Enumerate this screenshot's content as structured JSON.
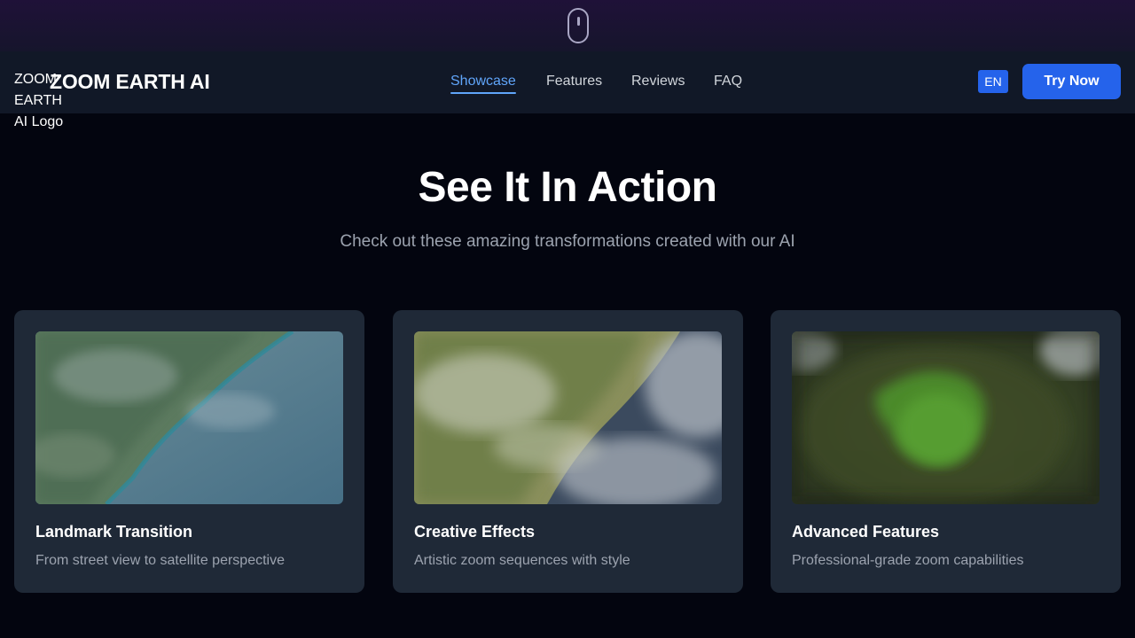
{
  "scroll_indicator": {
    "icon": "mouse-icon"
  },
  "header": {
    "logo_alt": "ZOOM EARTH AI Logo",
    "brand": "ZOOM EARTH AI",
    "nav": [
      {
        "label": "Showcase",
        "active": true
      },
      {
        "label": "Features",
        "active": false
      },
      {
        "label": "Reviews",
        "active": false
      },
      {
        "label": "FAQ",
        "active": false
      }
    ],
    "language": "EN",
    "cta": "Try Now"
  },
  "showcase": {
    "title": "See It In Action",
    "subtitle": "Check out these amazing transformations created with our AI",
    "cards": [
      {
        "title": "Landmark Transition",
        "description": "From street view to satellite perspective"
      },
      {
        "title": "Creative Effects",
        "description": "Artistic zoom sequences with style"
      },
      {
        "title": "Advanced Features",
        "description": "Professional-grade zoom capabilities"
      }
    ]
  },
  "colors": {
    "background": "#03050f",
    "navbar": "#111827",
    "card": "#1f2937",
    "accent": "#2563eb",
    "active_link": "#60a5fa",
    "muted_text": "#9ca3af"
  }
}
